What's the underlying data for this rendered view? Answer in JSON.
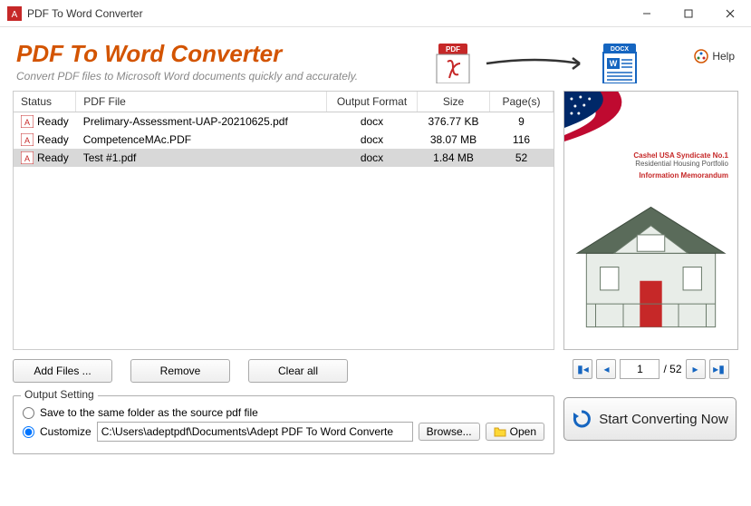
{
  "window": {
    "title": "PDF To Word Converter"
  },
  "header": {
    "title": "PDF To Word Converter",
    "subtitle": "Convert PDF files to Microsoft Word documents quickly and accurately.",
    "pdf_badge": "PDF",
    "docx_badge": "DOCX",
    "help_label": "Help"
  },
  "table": {
    "columns": {
      "status": "Status",
      "file": "PDF File",
      "format": "Output Format",
      "size": "Size",
      "pages": "Page(s)"
    },
    "rows": [
      {
        "status": "Ready",
        "file": "Prelimary-Assessment-UAP-20210625.pdf",
        "format": "docx",
        "size": "376.77 KB",
        "pages": "9",
        "selected": false
      },
      {
        "status": "Ready",
        "file": "CompetenceMAc.PDF",
        "format": "docx",
        "size": "38.07 MB",
        "pages": "116",
        "selected": false
      },
      {
        "status": "Ready",
        "file": "Test #1.pdf",
        "format": "docx",
        "size": "1.84 MB",
        "pages": "52",
        "selected": true
      }
    ]
  },
  "buttons": {
    "add": "Add Files ...",
    "remove": "Remove",
    "clear": "Clear all"
  },
  "output": {
    "legend": "Output Setting",
    "same_folder": "Save to the same folder as the source pdf file",
    "customize": "Customize",
    "path": "C:\\Users\\adeptpdf\\Documents\\Adept PDF To Word Converte",
    "browse": "Browse...",
    "open": "Open"
  },
  "pager": {
    "current": "1",
    "total": "/ 52"
  },
  "start": {
    "label": "Start Converting Now"
  },
  "preview": {
    "line1": "Cashel USA Syndicate No.1",
    "line2": "Residential Housing Portfolio",
    "line3": "Information Memorandum"
  }
}
